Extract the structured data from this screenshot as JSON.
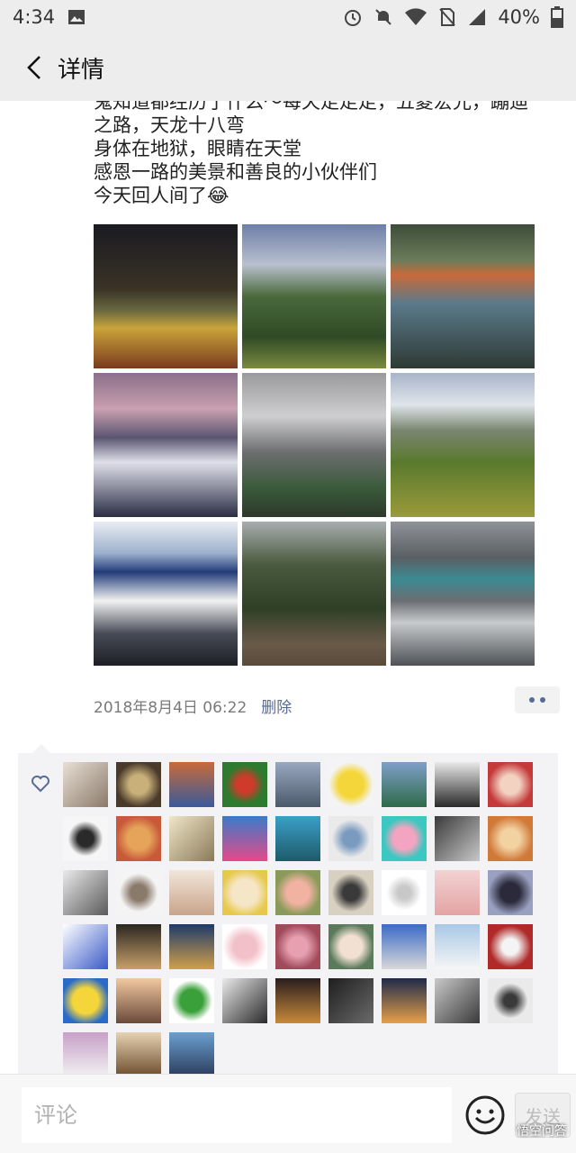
{
  "status_bar": {
    "time": "4:34",
    "battery": "40%"
  },
  "nav": {
    "title": "详情"
  },
  "post": {
    "lines": [
      "鬼知道都经历了什么～每天走走走，五菱宏光，蹦迪",
      "之路，天龙十八弯",
      "身体在地狱，眼睛在天堂",
      "感恩一路的美景和善良的小伙伴们",
      "今天回人间了😂"
    ]
  },
  "photos_count": 9,
  "meta": {
    "timestamp": "2018年8月4日 06:22",
    "delete_label": "删除"
  },
  "likes": {
    "avatar_count": 48
  },
  "bottom": {
    "comment_placeholder": "评论",
    "send_label": "发送",
    "watermark": "悟空问答"
  },
  "colors": {
    "link": "#576b95",
    "header_bg": "#ededed",
    "likes_bg": "#f3f3f5"
  }
}
